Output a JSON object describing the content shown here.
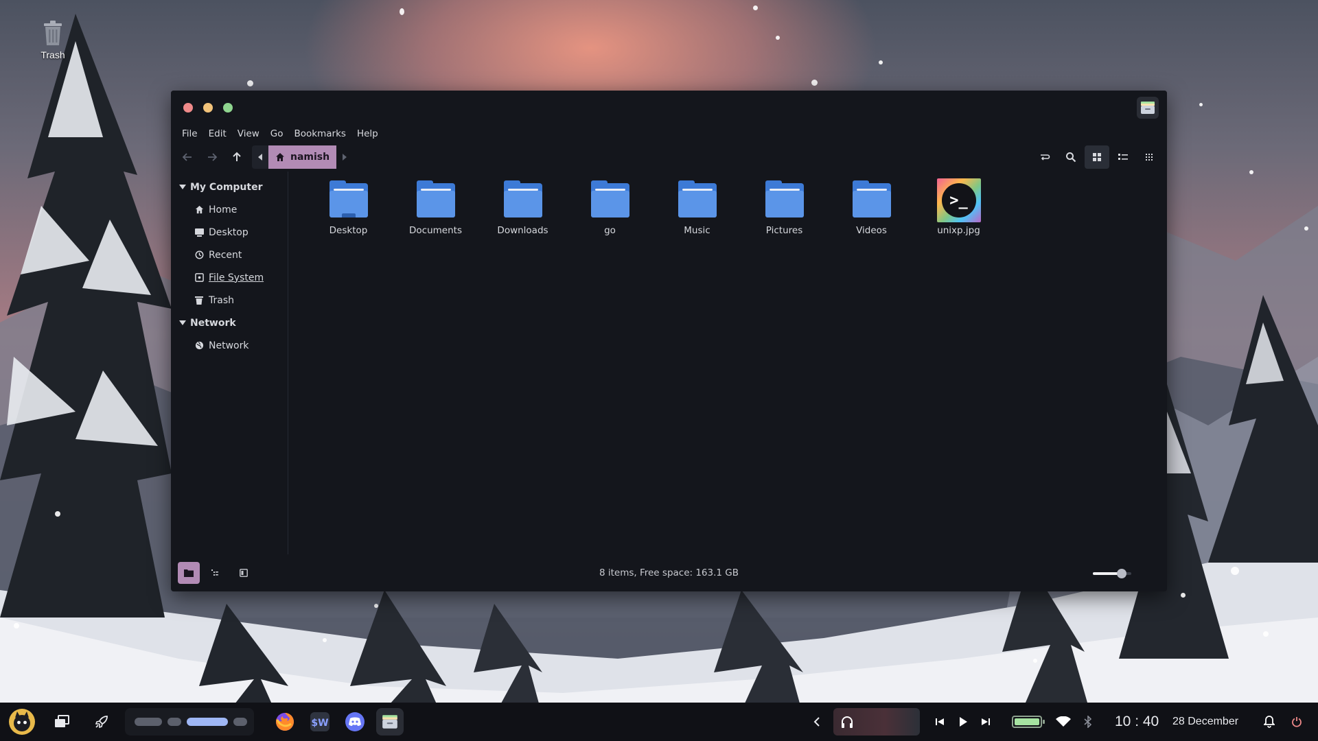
{
  "desktop": {
    "trash_label": "Trash"
  },
  "window": {
    "menu": [
      "File",
      "Edit",
      "View",
      "Go",
      "Bookmarks",
      "Help"
    ],
    "breadcrumb": {
      "current": "namish"
    },
    "sidebar": {
      "sections": [
        {
          "title": "My Computer",
          "items": [
            {
              "label": "Home",
              "icon": "home-icon"
            },
            {
              "label": "Desktop",
              "icon": "desktop-icon"
            },
            {
              "label": "Recent",
              "icon": "clock-icon"
            },
            {
              "label": "File System",
              "icon": "drive-icon"
            },
            {
              "label": "Trash",
              "icon": "trash-icon"
            }
          ]
        },
        {
          "title": "Network",
          "items": [
            {
              "label": "Network",
              "icon": "globe-icon"
            }
          ]
        }
      ]
    },
    "files": [
      {
        "name": "Desktop",
        "type": "folder-desktop"
      },
      {
        "name": "Documents",
        "type": "folder"
      },
      {
        "name": "Downloads",
        "type": "folder"
      },
      {
        "name": "go",
        "type": "folder"
      },
      {
        "name": "Music",
        "type": "folder"
      },
      {
        "name": "Pictures",
        "type": "folder"
      },
      {
        "name": "Videos",
        "type": "folder"
      },
      {
        "name": "unixp.jpg",
        "type": "image"
      }
    ],
    "status": "8 items, Free space: 163.1 GB",
    "zoom_level": 0.75
  },
  "taskbar": {
    "time": "10 : 40",
    "date": "28 December",
    "battery_level": 1.0,
    "apps": [
      "firefox-icon",
      "sw-icon",
      "discord-icon",
      "file-manager-icon"
    ]
  },
  "colors": {
    "accent": "#b28bb5",
    "folder": "#5b95e8",
    "window_bg": "#14161c"
  }
}
